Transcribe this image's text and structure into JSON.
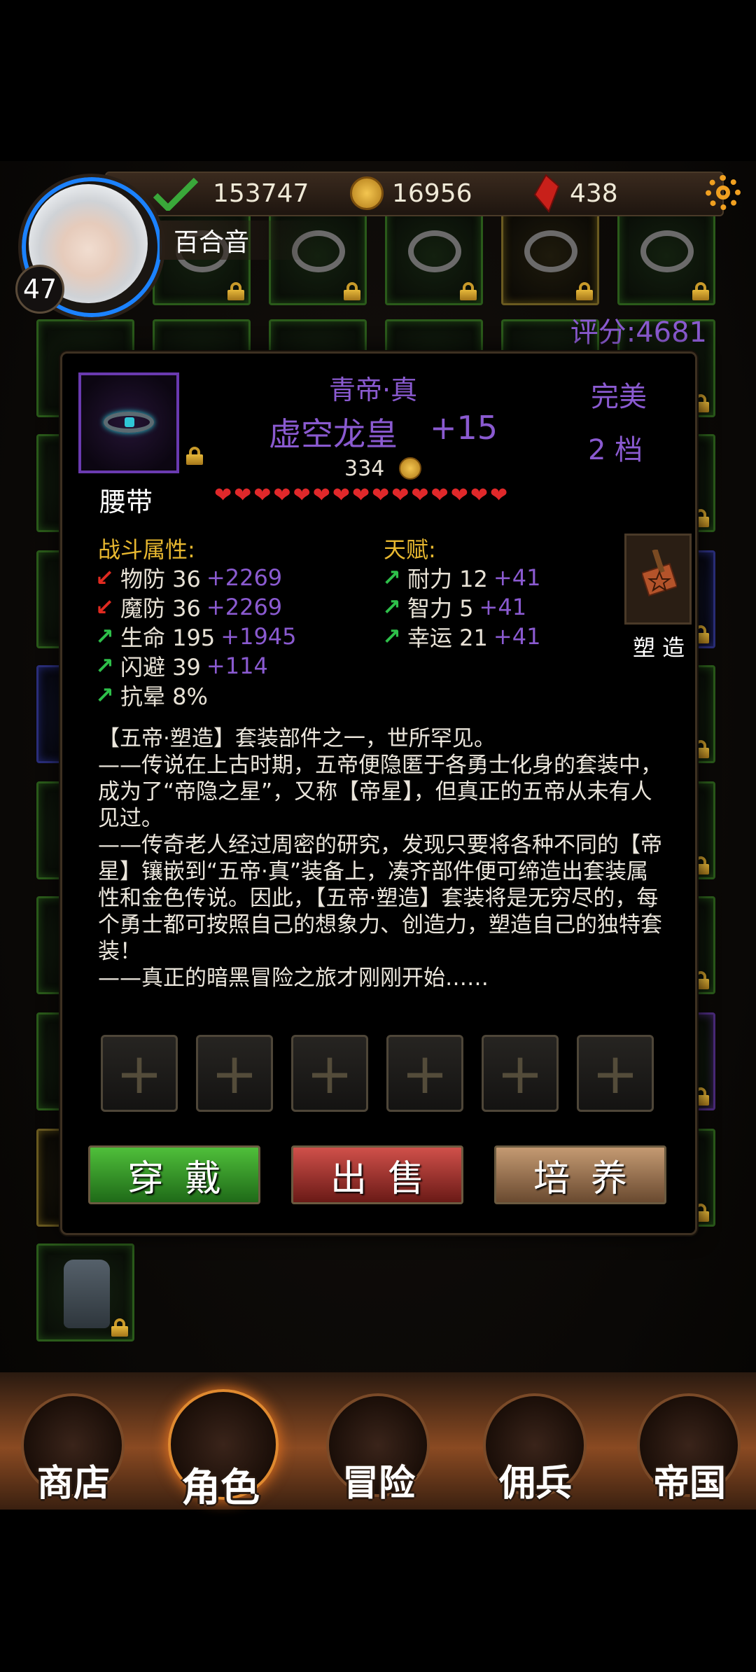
{
  "player": {
    "level": "47",
    "name": "百合音",
    "exp": "153747",
    "gold": "16956",
    "gems": "438",
    "score": "评分:4681"
  },
  "item": {
    "set_name": "青帝·真",
    "name": "虚空龙皇",
    "enhance": "+15",
    "quality": "完美",
    "tier": "2 档",
    "price": "334",
    "slot_type": "腰带",
    "stars": 15,
    "combat_title": "战斗属性:",
    "talent_title": "天赋:",
    "combat_stats": [
      {
        "label": "物防 36",
        "bonus": "+2269",
        "trend": "down"
      },
      {
        "label": "魔防 36",
        "bonus": "+2269",
        "trend": "down"
      },
      {
        "label": "生命 195",
        "bonus": "+1945",
        "trend": "up"
      },
      {
        "label": "闪避 39",
        "bonus": "+114",
        "trend": "up"
      },
      {
        "label": "抗晕 8%",
        "bonus": "",
        "trend": "up"
      }
    ],
    "talent_stats": [
      {
        "label": "耐力 12",
        "bonus": "+41",
        "trend": "up"
      },
      {
        "label": "智力 5",
        "bonus": "+41",
        "trend": "up"
      },
      {
        "label": "幸运 21",
        "bonus": "+41",
        "trend": "up"
      }
    ],
    "forge_label": "塑 造",
    "description": [
      "【五帝·塑造】套装部件之一，世所罕见。",
      "——传说在上古时期，五帝便隐匿于各勇士化身的套装中，成为了“帝隐之星”，又称【帝星】，但真正的五帝从未有人见过。",
      "——传奇老人经过周密的研究，发现只要将各种不同的【帝星】镶嵌到“五帝·真”装备上，凑齐部件便可缔造出套装属性和金色传说。因此，【五帝·塑造】套装将是无穷尽的，每个勇士都可按照自己的想象力、创造力，塑造自己的独特套装！",
      "——真正的暗黑冒险之旅才刚刚开始……"
    ],
    "sockets": [
      "+",
      "+",
      "+",
      "+",
      "+",
      "+"
    ]
  },
  "actions": {
    "equip": "穿戴",
    "sell": "出售",
    "train": "培养"
  },
  "nav": [
    {
      "label": "商店"
    },
    {
      "label": "角色"
    },
    {
      "label": "冒险"
    },
    {
      "label": "佣兵"
    },
    {
      "label": "帝国"
    }
  ],
  "colors": {
    "accent_purple": "#8a5ad0",
    "gold_text": "#e8b830",
    "heart_red": "#e0282a"
  }
}
